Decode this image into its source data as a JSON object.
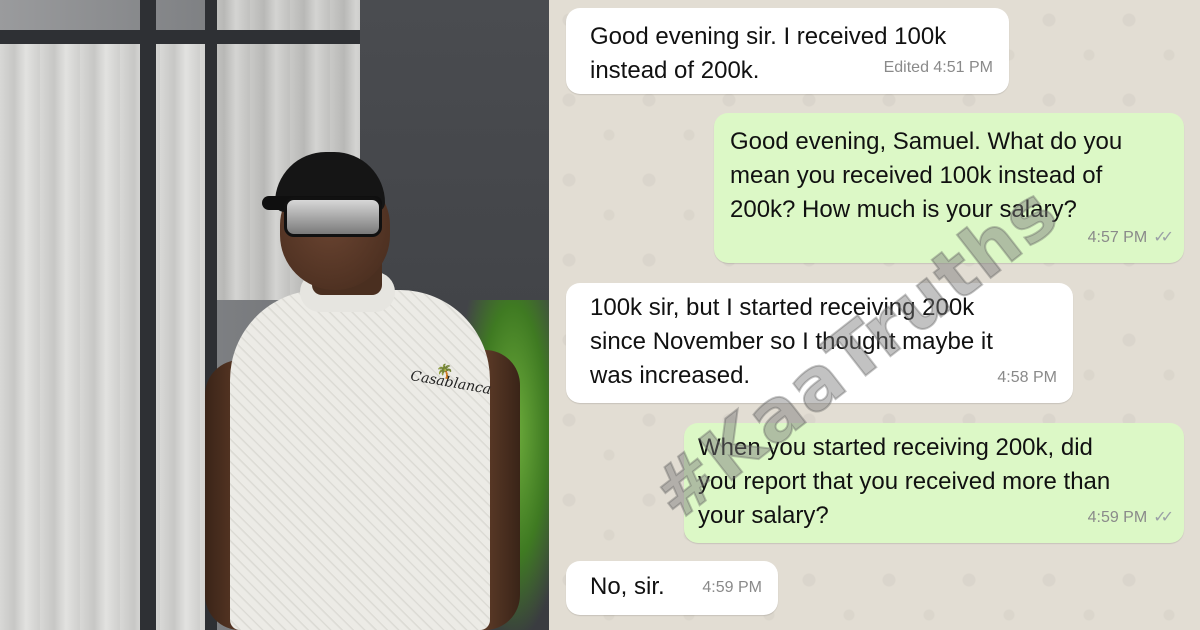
{
  "photo": {
    "shirt_logo_text": "Casablanca"
  },
  "messages": [
    {
      "direction": "incoming",
      "text": "Good evening sir. I received 100k\ninstead of 200k.",
      "meta": "Edited 4:51 PM",
      "read": false
    },
    {
      "direction": "outgoing",
      "text": "Good evening, Samuel. What do you\nmean you received 100k instead of\n200k? How much is your salary?",
      "meta": "4:57 PM",
      "read": true
    },
    {
      "direction": "incoming",
      "text": "100k sir, but I started receiving 200k\nsince November so I thought maybe it\nwas increased.",
      "meta": "4:58 PM",
      "read": false
    },
    {
      "direction": "outgoing",
      "text": "When you started receiving 200k, did\nyou report that you received more than\nyour salary?",
      "meta": "4:59 PM",
      "read": true
    },
    {
      "direction": "incoming",
      "text": "No, sir.",
      "meta": "4:59 PM",
      "read": false
    }
  ],
  "watermark": "#KaaTruths",
  "colors": {
    "incoming_bubble": "#ffffff",
    "outgoing_bubble": "#dcf8c6",
    "chat_background": "#e2ddd3",
    "timestamp": "#8a8a8a"
  },
  "icons": {
    "read_receipt": "double-check-icon"
  }
}
